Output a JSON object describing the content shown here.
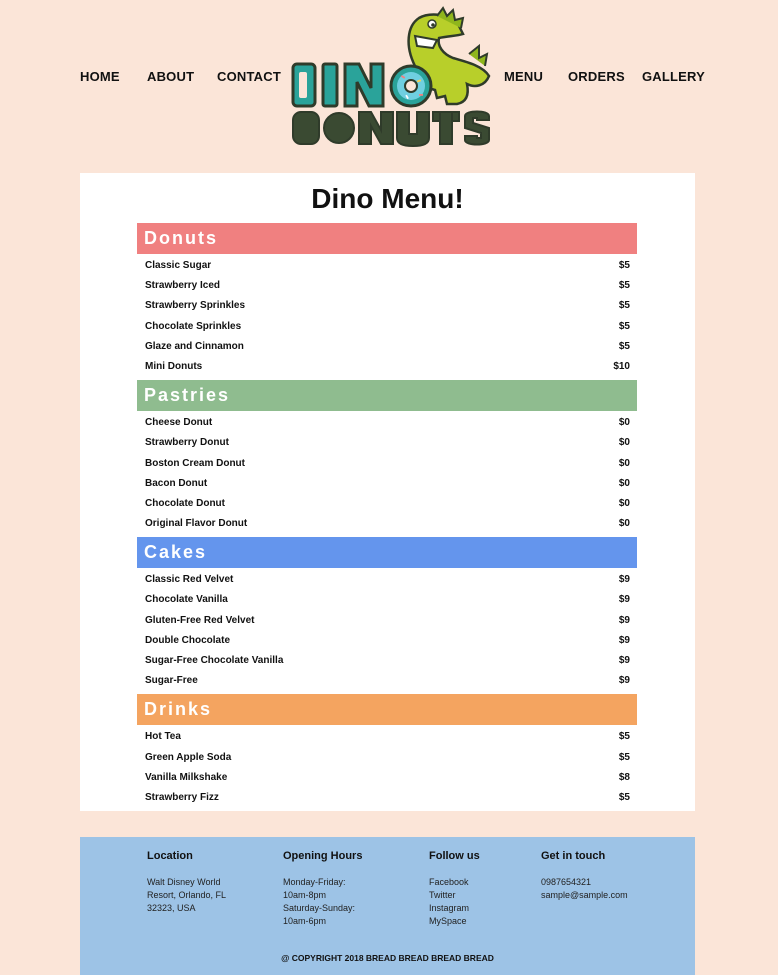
{
  "nav": {
    "left": [
      "HOME",
      "ABOUT",
      "CONTACT"
    ],
    "right": [
      "MENU",
      "ORDERS",
      "GALLERY"
    ]
  },
  "logo": {
    "line1": "DINO",
    "line2": "DONUTS",
    "colors": {
      "teal": "#2aa39a",
      "dark": "#2f3b2a",
      "dino": "#b8cf2a"
    }
  },
  "menu": {
    "title": "Dino Menu!",
    "sections": [
      {
        "name": "Donuts",
        "color": "#f08080",
        "items": [
          {
            "name": "Classic Sugar",
            "price": "$5"
          },
          {
            "name": "Strawberry Iced",
            "price": "$5"
          },
          {
            "name": "Strawberry Sprinkles",
            "price": "$5"
          },
          {
            "name": "Chocolate Sprinkles",
            "price": "$5"
          },
          {
            "name": "Glaze and Cinnamon",
            "price": "$5"
          },
          {
            "name": "Mini Donuts",
            "price": "$10"
          }
        ]
      },
      {
        "name": "Pastries",
        "color": "#8fbc8f",
        "items": [
          {
            "name": "Cheese Donut",
            "price": "$0"
          },
          {
            "name": "Strawberry Donut",
            "price": "$0"
          },
          {
            "name": "Boston Cream Donut",
            "price": "$0"
          },
          {
            "name": "Bacon Donut",
            "price": "$0"
          },
          {
            "name": "Chocolate Donut",
            "price": "$0"
          },
          {
            "name": "Original Flavor Donut",
            "price": "$0"
          }
        ]
      },
      {
        "name": "Cakes",
        "color": "#6495ed",
        "items": [
          {
            "name": "Classic Red Velvet",
            "price": "$9"
          },
          {
            "name": "Chocolate Vanilla",
            "price": "$9"
          },
          {
            "name": "Gluten-Free Red Velvet",
            "price": "$9"
          },
          {
            "name": "Double Chocolate",
            "price": "$9"
          },
          {
            "name": "Sugar-Free Chocolate Vanilla",
            "price": "$9"
          },
          {
            "name": "Sugar-Free",
            "price": "$9"
          }
        ]
      },
      {
        "name": "Drinks",
        "color": "#f4a460",
        "items": [
          {
            "name": "Hot Tea",
            "price": "$5"
          },
          {
            "name": "Green Apple Soda",
            "price": "$5"
          },
          {
            "name": "Vanilla Milkshake",
            "price": "$8"
          },
          {
            "name": "Strawberry Fizz",
            "price": "$5"
          }
        ]
      }
    ]
  },
  "footer": {
    "columns": [
      {
        "title": "Location",
        "lines": [
          "Walt Disney World",
          "Resort, Orlando, FL",
          "32323, USA"
        ]
      },
      {
        "title": "Opening Hours",
        "lines": [
          "Monday-Friday:",
          "10am-8pm",
          "Saturday-Sunday:",
          "10am-6pm"
        ]
      },
      {
        "title": "Follow us",
        "lines": [
          "Facebook",
          "Twitter",
          "Instagram",
          "MySpace"
        ]
      },
      {
        "title": "Get in touch",
        "lines": [
          "0987654321",
          "sample@sample.com"
        ]
      }
    ],
    "copyright": "@ COPYRIGHT 2018 BREAD BREAD BREAD BREAD"
  }
}
